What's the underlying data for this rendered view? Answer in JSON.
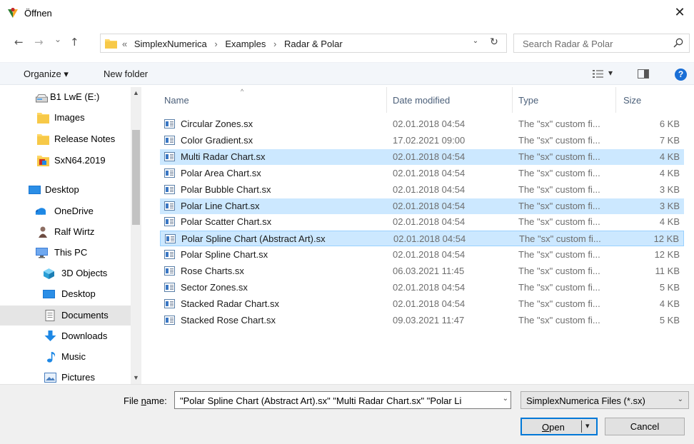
{
  "window": {
    "title": "Öffnen",
    "close_symbol": "✕"
  },
  "navigation": {
    "back_symbol": "←",
    "forward_symbol": "→",
    "recent_symbol": "⌄",
    "up_symbol": "↑",
    "breadcrumb_prefix": "«",
    "breadcrumb": [
      "SimplexNumerica",
      "Examples",
      "Radar & Polar"
    ],
    "breadcrumb_separator": "›",
    "address_dropdown_symbol": "⌄",
    "refresh_symbol": "↻",
    "search_placeholder": "Search Radar & Polar"
  },
  "toolbar": {
    "organize_label": "Organize ▾",
    "new_folder_label": "New folder",
    "view_dropdown_symbol": "▾",
    "help_label": "?"
  },
  "sidebar": {
    "scroll_up_symbol": "▲",
    "scroll_down_symbol": "▼",
    "items": [
      {
        "label": "B1 LwE (E:)",
        "icon": "drive-icon"
      },
      {
        "label": "Images",
        "icon": "folder-icon"
      },
      {
        "label": "Release Notes",
        "icon": "folder-icon"
      },
      {
        "label": "SxN64.2019",
        "icon": "app-folder-icon"
      },
      {
        "label": "Desktop",
        "icon": "desktop-icon"
      },
      {
        "label": "OneDrive",
        "icon": "onedrive-icon"
      },
      {
        "label": "Ralf Wirtz",
        "icon": "user-icon"
      },
      {
        "label": "This PC",
        "icon": "pc-icon"
      },
      {
        "label": "3D Objects",
        "icon": "3d-objects-icon"
      },
      {
        "label": "Desktop",
        "icon": "desktop-icon"
      },
      {
        "label": "Documents",
        "icon": "documents-icon"
      },
      {
        "label": "Downloads",
        "icon": "downloads-icon"
      },
      {
        "label": "Music",
        "icon": "music-icon"
      },
      {
        "label": "Pictures",
        "icon": "pictures-icon"
      }
    ],
    "selected_item": "Documents"
  },
  "filelist": {
    "columns": {
      "name": "Name",
      "date": "Date modified",
      "type": "Type",
      "size": "Size",
      "sort_symbol": "^"
    },
    "rows": [
      {
        "name": "Circular Zones.sx",
        "date": "02.01.2018 04:54",
        "type": "The \"sx\" custom fi...",
        "size": "6 KB",
        "selected": false
      },
      {
        "name": "Color Gradient.sx",
        "date": "17.02.2021 09:00",
        "type": "The \"sx\" custom fi...",
        "size": "7 KB",
        "selected": false
      },
      {
        "name": "Multi Radar Chart.sx",
        "date": "02.01.2018 04:54",
        "type": "The \"sx\" custom fi...",
        "size": "4 KB",
        "selected": true
      },
      {
        "name": "Polar Area Chart.sx",
        "date": "02.01.2018 04:54",
        "type": "The \"sx\" custom fi...",
        "size": "4 KB",
        "selected": false
      },
      {
        "name": "Polar Bubble Chart.sx",
        "date": "02.01.2018 04:54",
        "type": "The \"sx\" custom fi...",
        "size": "3 KB",
        "selected": false
      },
      {
        "name": "Polar Line Chart.sx",
        "date": "02.01.2018 04:54",
        "type": "The \"sx\" custom fi...",
        "size": "3 KB",
        "selected": true
      },
      {
        "name": "Polar Scatter Chart.sx",
        "date": "02.01.2018 04:54",
        "type": "The \"sx\" custom fi...",
        "size": "4 KB",
        "selected": false
      },
      {
        "name": "Polar Spline Chart (Abstract Art).sx",
        "date": "02.01.2018 04:54",
        "type": "The \"sx\" custom fi...",
        "size": "12 KB",
        "selected": true,
        "focused": true
      },
      {
        "name": "Polar Spline Chart.sx",
        "date": "02.01.2018 04:54",
        "type": "The \"sx\" custom fi...",
        "size": "12 KB",
        "selected": false
      },
      {
        "name": "Rose Charts.sx",
        "date": "06.03.2021 11:45",
        "type": "The \"sx\" custom fi...",
        "size": "11 KB",
        "selected": false
      },
      {
        "name": "Sector Zones.sx",
        "date": "02.01.2018 04:54",
        "type": "The \"sx\" custom fi...",
        "size": "5 KB",
        "selected": false
      },
      {
        "name": "Stacked Radar Chart.sx",
        "date": "02.01.2018 04:54",
        "type": "The \"sx\" custom fi...",
        "size": "4 KB",
        "selected": false
      },
      {
        "name": "Stacked Rose Chart.sx",
        "date": "09.03.2021 11:47",
        "type": "The \"sx\" custom fi...",
        "size": "5 KB",
        "selected": false
      }
    ]
  },
  "footer": {
    "file_name_label_pre": "File ",
    "file_name_label_u": "n",
    "file_name_label_post": "ame:",
    "file_name_value": "\"Polar Spline Chart (Abstract Art).sx\" \"Multi Radar Chart.sx\" \"Polar Li",
    "file_type_value": "SimplexNumerica Files (*.sx)",
    "dropdown_symbol": "⌄",
    "open_label_u": "O",
    "open_label_rest": "pen",
    "open_dropdown_symbol": "▾",
    "cancel_label": "Cancel"
  },
  "colors": {
    "selection_bg": "#cce8ff",
    "selection_border": "#99d1ff",
    "accent": "#0078d7",
    "toolbar_bg": "#f3f6fa"
  }
}
